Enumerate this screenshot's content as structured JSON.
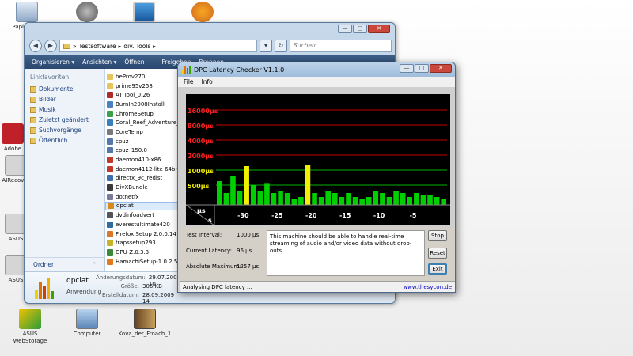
{
  "desktop": {
    "icons": [
      {
        "label": "Papierkorb",
        "icon": "recycle-bin-icon"
      },
      {
        "label": "",
        "icon": "network-icon"
      },
      {
        "label": "",
        "icon": "monitor-icon"
      },
      {
        "label": "",
        "icon": "app-icon"
      },
      {
        "label": "Adobe",
        "icon": "adobe-icon"
      },
      {
        "label": "AIRecover",
        "icon": "app-icon"
      },
      {
        "label": "ASUS",
        "icon": "app-icon"
      },
      {
        "label": "ASUS",
        "icon": "app-icon"
      },
      {
        "label": "ASUS WebStorage",
        "icon": "app-icon"
      },
      {
        "label": "Computer",
        "icon": "computer-icon"
      },
      {
        "label": "Kova_der_Froach_1",
        "icon": "video-icon"
      }
    ]
  },
  "explorer": {
    "address_parts": [
      "Testsoftware",
      "div. Tools"
    ],
    "search_placeholder": "Suchen",
    "toolbar": {
      "organize": "Organisieren ▾",
      "views": "Ansichten ▾",
      "open": "Öffnen",
      "share": "Freigeben",
      "burn": "Brennen"
    },
    "favorites_header": "Linkfavoriten",
    "favorites": [
      "Dokumente",
      "Bilder",
      "Musik",
      "Zuletzt geändert",
      "Suchvorgänge",
      "Öffentlich"
    ],
    "folders_label": "Ordner",
    "files": [
      {
        "name": "beProv270",
        "color": "#e8c45c"
      },
      {
        "name": "prime95v258",
        "color": "#e8c45c"
      },
      {
        "name": "ATITool_0.26",
        "color": "#b12a2a"
      },
      {
        "name": "BurnIn2008Install",
        "color": "#4a7fc1"
      },
      {
        "name": "ChromeSetup",
        "color": "#3aa04a"
      },
      {
        "name": "Coral_Reef_Adventure_...",
        "color": "#3a7fb8"
      },
      {
        "name": "CoreTemp",
        "color": "#7a7a7a"
      },
      {
        "name": "cpuz",
        "color": "#5577aa"
      },
      {
        "name": "cpuz_150.0",
        "color": "#5577aa"
      },
      {
        "name": "daemon410-x86",
        "color": "#c0392b"
      },
      {
        "name": "daemon4112-lite 64bit",
        "color": "#c0392b"
      },
      {
        "name": "directx_9c_redist",
        "color": "#3a6fb0"
      },
      {
        "name": "DivXBundle",
        "color": "#3a3a3a"
      },
      {
        "name": "dotnetfx",
        "color": "#7a7a9a"
      },
      {
        "name": "dpclat",
        "color": "#d98a1a"
      },
      {
        "name": "dvdinfoadvert",
        "color": "#555"
      },
      {
        "name": "everestultimate420",
        "color": "#2f6ca0"
      },
      {
        "name": "Firefox Setup 2.0.0.14",
        "color": "#d9782a"
      },
      {
        "name": "frapssetup293",
        "color": "#c9b12a"
      },
      {
        "name": "GPU-Z.0.3.3",
        "color": "#3a8a3a"
      },
      {
        "name": "HamachiSetup-1.0.2.5-...",
        "color": "#e07a1a"
      }
    ],
    "details": {
      "name": "dpclat",
      "type": "Anwendung",
      "modified_label": "Änderungsdatum:",
      "modified": "29.07.2009 10",
      "size_label": "Größe:",
      "size": "306 KB",
      "created_label": "Erstelldatum:",
      "created": "28.09.2009 14"
    }
  },
  "dpc": {
    "title": "DPC Latency Checker V1.1.0",
    "menu": [
      "File",
      "Info"
    ],
    "test_interval_label": "Test Interval:",
    "test_interval": "1000 µs",
    "current_latency_label": "Current Latency:",
    "current_latency": "96 µs",
    "absolute_max_label": "Absolute Maximum:",
    "absolute_max": "1257 µs",
    "message": "This machine should be able to handle real-time streaming of audio and/or video data without drop-outs.",
    "buttons": {
      "stop": "Stop",
      "reset": "Reset",
      "exit": "Exit"
    },
    "status": "Analysing DPC latency ...",
    "link": "www.thesycon.de"
  },
  "chart_data": {
    "type": "bar",
    "y_axis_labels": [
      "16000µs",
      "8000µs",
      "4000µs",
      "2000µs",
      "1000µs",
      "500µs"
    ],
    "y_levels": [
      16000,
      8000,
      4000,
      2000,
      1000,
      500
    ],
    "x_unit_label": "s",
    "y_unit_label": "µs",
    "x_tick_labels": [
      "-30",
      "-25",
      "-20",
      "-15",
      "-10",
      "-5"
    ],
    "x_ticks": [
      -30,
      -25,
      -20,
      -15,
      -10,
      -5
    ],
    "xlim": [
      -34,
      0
    ],
    "colors": {
      "normal": "#00d000",
      "high": "#f0f000",
      "background": "#000000",
      "gridline_red": "#c00000",
      "gridline_green": "#00b000"
    },
    "bars": [
      {
        "t": -34,
        "v": 600,
        "c": "normal"
      },
      {
        "t": -33,
        "v": 300,
        "c": "normal"
      },
      {
        "t": -32,
        "v": 750,
        "c": "normal"
      },
      {
        "t": -31,
        "v": 350,
        "c": "normal"
      },
      {
        "t": -30,
        "v": 1200,
        "c": "high"
      },
      {
        "t": -29,
        "v": 500,
        "c": "normal"
      },
      {
        "t": -28,
        "v": 350,
        "c": "normal"
      },
      {
        "t": -27,
        "v": 550,
        "c": "normal"
      },
      {
        "t": -26,
        "v": 300,
        "c": "normal"
      },
      {
        "t": -25,
        "v": 350,
        "c": "normal"
      },
      {
        "t": -24,
        "v": 300,
        "c": "normal"
      },
      {
        "t": -23,
        "v": 150,
        "c": "normal"
      },
      {
        "t": -22,
        "v": 200,
        "c": "normal"
      },
      {
        "t": -21,
        "v": 1257,
        "c": "high"
      },
      {
        "t": -20,
        "v": 300,
        "c": "normal"
      },
      {
        "t": -19,
        "v": 200,
        "c": "normal"
      },
      {
        "t": -18,
        "v": 350,
        "c": "normal"
      },
      {
        "t": -17,
        "v": 300,
        "c": "normal"
      },
      {
        "t": -16,
        "v": 200,
        "c": "normal"
      },
      {
        "t": -15,
        "v": 300,
        "c": "normal"
      },
      {
        "t": -14,
        "v": 200,
        "c": "normal"
      },
      {
        "t": -13,
        "v": 150,
        "c": "normal"
      },
      {
        "t": -12,
        "v": 200,
        "c": "normal"
      },
      {
        "t": -11,
        "v": 350,
        "c": "normal"
      },
      {
        "t": -10,
        "v": 300,
        "c": "normal"
      },
      {
        "t": -9,
        "v": 200,
        "c": "normal"
      },
      {
        "t": -8,
        "v": 350,
        "c": "normal"
      },
      {
        "t": -7,
        "v": 300,
        "c": "normal"
      },
      {
        "t": -6,
        "v": 200,
        "c": "normal"
      },
      {
        "t": -5,
        "v": 300,
        "c": "normal"
      },
      {
        "t": -4,
        "v": 250,
        "c": "normal"
      },
      {
        "t": -3,
        "v": 250,
        "c": "normal"
      },
      {
        "t": -2,
        "v": 200,
        "c": "normal"
      },
      {
        "t": -1,
        "v": 150,
        "c": "normal"
      }
    ]
  }
}
